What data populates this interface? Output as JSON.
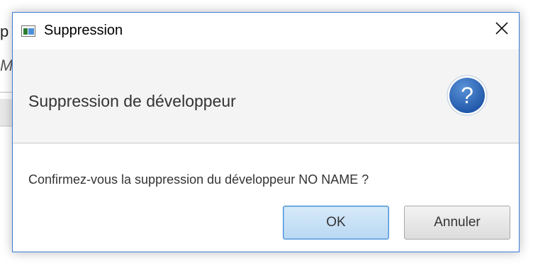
{
  "window": {
    "title": "Suppression",
    "close_icon": "close-icon",
    "app_icon": "app-window-icon"
  },
  "header": {
    "text": "Suppression de développeur",
    "icon": "question-icon",
    "icon_glyph": "?",
    "icon_color": "#2e67b5"
  },
  "content": {
    "message": "Confirmez-vous la suppression du développeur NO NAME ?"
  },
  "buttons": {
    "ok_label": "OK",
    "cancel_label": "Annuler"
  },
  "colors": {
    "accent": "#3d7bd9",
    "ok_button_bg": "#c6e0f6",
    "header_bg": "#f4f4f4"
  }
}
